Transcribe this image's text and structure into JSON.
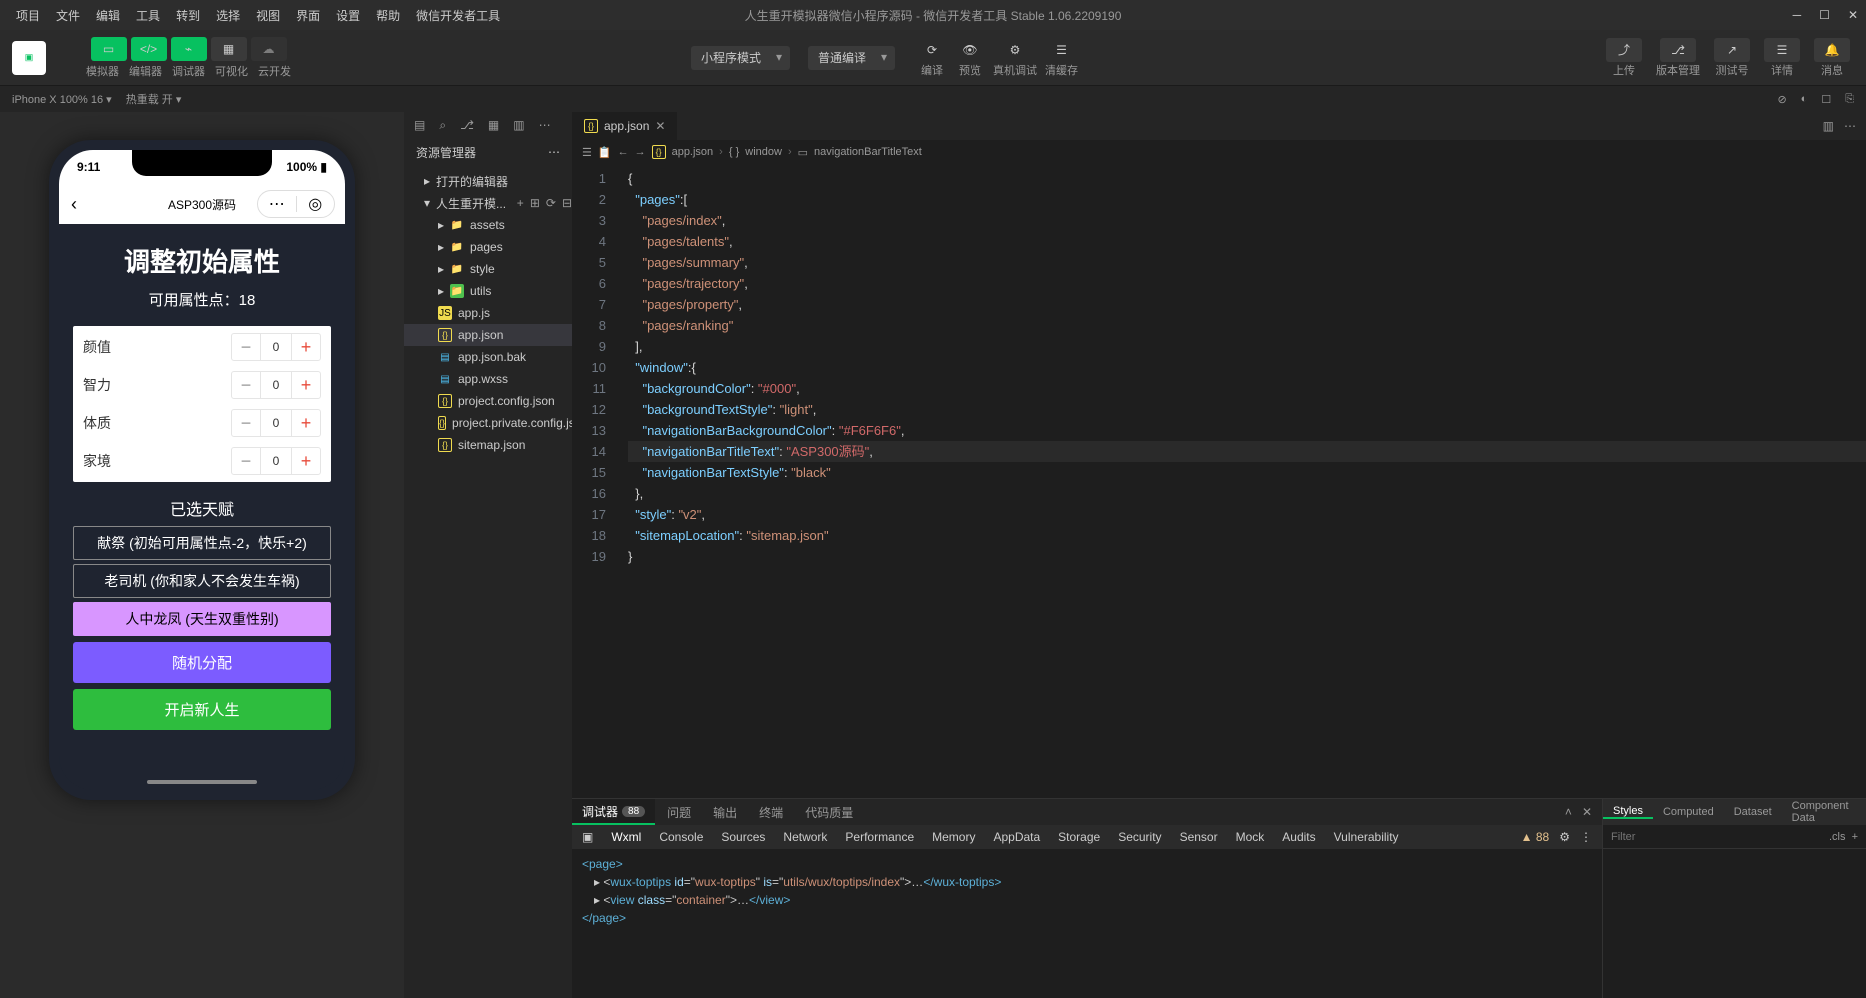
{
  "menubar": {
    "items": [
      "项目",
      "文件",
      "编辑",
      "工具",
      "转到",
      "选择",
      "视图",
      "界面",
      "设置",
      "帮助",
      "微信开发者工具"
    ],
    "title": "人生重开模拟器微信小程序源码 - 微信开发者工具 Stable 1.06.2209190"
  },
  "toolbar": {
    "groups": [
      {
        "label": "模拟器"
      },
      {
        "label": "编辑器"
      },
      {
        "label": "调试器"
      },
      {
        "label": "可视化"
      },
      {
        "label": "云开发"
      }
    ],
    "modeSelect": "小程序模式",
    "compileSelect": "普通编译",
    "actions": [
      {
        "label": "编译"
      },
      {
        "label": "预览"
      },
      {
        "label": "真机调试"
      },
      {
        "label": "清缓存"
      }
    ],
    "right": [
      {
        "label": "上传"
      },
      {
        "label": "版本管理"
      },
      {
        "label": "测试号"
      },
      {
        "label": "详情"
      },
      {
        "label": "消息"
      }
    ]
  },
  "subbar": {
    "device": "iPhone X 100% 16 ▾",
    "hot": "热重载 开 ▾"
  },
  "simulator": {
    "time": "9:11",
    "battery": "100%",
    "navTitle": "ASP300源码",
    "pageTitle": "调整初始属性",
    "pointsLabel": "可用属性点：",
    "pointsValue": "18",
    "props": [
      {
        "name": "颜值",
        "val": "0"
      },
      {
        "name": "智力",
        "val": "0"
      },
      {
        "name": "体质",
        "val": "0"
      },
      {
        "name": "家境",
        "val": "0"
      }
    ],
    "talentTitle": "已选天赋",
    "talents": [
      {
        "text": "献祭 (初始可用属性点-2，快乐+2)",
        "cls": ""
      },
      {
        "text": "老司机 (你和家人不会发生车祸)",
        "cls": ""
      },
      {
        "text": "人中龙凤 (天生双重性别)",
        "cls": "purple"
      }
    ],
    "btnRandom": "随机分配",
    "btnStart": "开启新人生"
  },
  "explorer": {
    "title": "资源管理器",
    "section1": "打开的编辑器",
    "projectName": "人生重开模...",
    "tree": [
      {
        "icon": "folder",
        "name": "assets",
        "lvl": 2
      },
      {
        "icon": "folder",
        "name": "pages",
        "lvl": 2
      },
      {
        "icon": "folder",
        "name": "style",
        "lvl": 2
      },
      {
        "icon": "folder",
        "name": "utils",
        "lvl": 2,
        "green": true
      },
      {
        "icon": "js",
        "name": "app.js",
        "lvl": 2
      },
      {
        "icon": "json",
        "name": "app.json",
        "lvl": 2,
        "sel": true
      },
      {
        "icon": "bak",
        "name": "app.json.bak",
        "lvl": 2
      },
      {
        "icon": "wxss",
        "name": "app.wxss",
        "lvl": 2
      },
      {
        "icon": "json",
        "name": "project.config.json",
        "lvl": 2
      },
      {
        "icon": "json",
        "name": "project.private.config.js...",
        "lvl": 2
      },
      {
        "icon": "json",
        "name": "sitemap.json",
        "lvl": 2
      }
    ]
  },
  "editor": {
    "tabName": "app.json",
    "breadcrumb": [
      "app.json",
      "window",
      "navigationBarTitleText"
    ],
    "lines": 19,
    "code": {
      "pages": [
        "pages/index",
        "pages/talents",
        "pages/summary",
        "pages/trajectory",
        "pages/property",
        "pages/ranking"
      ],
      "window": {
        "backgroundColor": "#000",
        "backgroundTextStyle": "light",
        "navigationBarBackgroundColor": "#F6F6F6",
        "navigationBarTitleText": "ASP300源码",
        "navigationBarTextStyle": "black"
      },
      "style": "v2",
      "sitemapLocation": "sitemap.json"
    }
  },
  "console": {
    "topTabs": [
      {
        "label": "调试器",
        "badge": "88",
        "active": true
      },
      {
        "label": "问题"
      },
      {
        "label": "输出"
      },
      {
        "label": "终端"
      },
      {
        "label": "代码质量"
      }
    ],
    "devTabs": [
      "Wxml",
      "Console",
      "Sources",
      "Network",
      "Performance",
      "Memory",
      "AppData",
      "Storage",
      "Security",
      "Sensor",
      "Mock",
      "Audits",
      "Vulnerability"
    ],
    "devActive": "Wxml",
    "warnCount": "88",
    "dom": {
      "l1": "<page>",
      "l2_tag": "wux-toptips",
      "l2_id": "wux-toptips",
      "l2_is": "utils/wux/toptips/index",
      "l2_close": "</wux-toptips>",
      "l3_tag": "view",
      "l3_class": "container",
      "l3_close": "</view>",
      "l4": "</page>"
    },
    "stylesTabs": [
      "Styles",
      "Computed",
      "Dataset",
      "Component Data"
    ],
    "filterPlaceholder": "Filter",
    "cls": ".cls"
  }
}
